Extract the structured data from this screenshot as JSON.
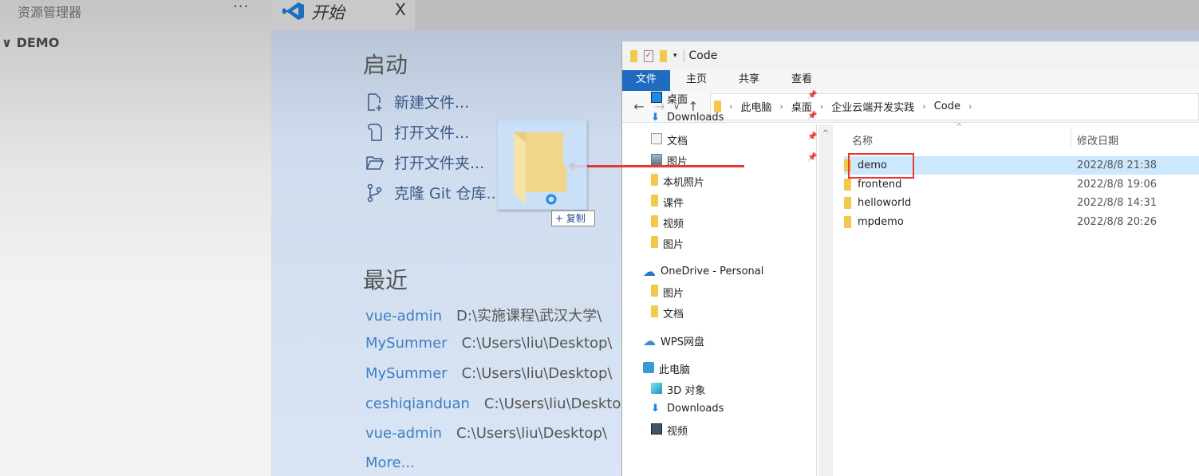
{
  "sidebar": {
    "title": "资源管理器",
    "more": "···",
    "folder": "DEMO"
  },
  "tab": {
    "label": "开始",
    "close": "X"
  },
  "start": {
    "heading": "启动",
    "items": [
      {
        "label": "新建文件...",
        "icon": "new-file-icon"
      },
      {
        "label": "打开文件...",
        "icon": "open-file-icon"
      },
      {
        "label": "打开文件夹...",
        "icon": "open-folder-icon"
      },
      {
        "label": "克隆 Git 仓库...",
        "icon": "git-branch-icon"
      }
    ]
  },
  "recent": {
    "heading": "最近",
    "items": [
      {
        "name": "vue-admin",
        "path": "D:\\实施课程\\武汉大学\\"
      },
      {
        "name": "MySummer",
        "path": "C:\\Users\\liu\\Desktop\\"
      },
      {
        "name": "MySummer",
        "path": "C:\\Users\\liu\\Desktop\\"
      },
      {
        "name": "ceshiqianduan",
        "path": "C:\\Users\\liu\\Desktop\\"
      },
      {
        "name": "vue-admin",
        "path": "C:\\Users\\liu\\Desktop\\"
      }
    ],
    "more": "More..."
  },
  "drag": {
    "tooltip": "+ 复制"
  },
  "explorer": {
    "title": "Code",
    "ribbon": [
      "文件",
      "主页",
      "共享",
      "查看"
    ],
    "breadcrumb": [
      "此电脑",
      "桌面",
      "企业云端开发实践",
      "Code"
    ],
    "nav_items": [
      {
        "label": "桌面",
        "icon": "desktop-icon",
        "pinned": true
      },
      {
        "label": "Downloads",
        "icon": "download-icon",
        "pinned": true
      },
      {
        "label": "文档",
        "icon": "document-icon",
        "pinned": true
      },
      {
        "label": "图片",
        "icon": "picture-icon",
        "pinned": true
      },
      {
        "label": "本机照片",
        "icon": "folder-icon"
      },
      {
        "label": "课件",
        "icon": "folder-icon"
      },
      {
        "label": "视频",
        "icon": "folder-icon"
      },
      {
        "label": "图片",
        "icon": "folder-icon"
      },
      {
        "label": "OneDrive - Personal",
        "icon": "onedrive-icon"
      },
      {
        "label": "图片",
        "icon": "folder-icon"
      },
      {
        "label": "文档",
        "icon": "folder-icon"
      },
      {
        "label": "WPS网盘",
        "icon": "cloud-icon"
      },
      {
        "label": "此电脑",
        "icon": "computer-icon"
      },
      {
        "label": "3D 对象",
        "icon": "3d-icon"
      },
      {
        "label": "Downloads",
        "icon": "download-icon"
      },
      {
        "label": "视频",
        "icon": "video-icon"
      }
    ],
    "columns": {
      "name": "名称",
      "date": "修改日期"
    },
    "files": [
      {
        "name": "demo",
        "date": "2022/8/8 21:38",
        "selected": true
      },
      {
        "name": "frontend",
        "date": "2022/8/8 19:06"
      },
      {
        "name": "helloworld",
        "date": "2022/8/8 14:31"
      },
      {
        "name": "mpdemo",
        "date": "2022/8/8 20:26"
      }
    ]
  },
  "colors": {
    "accent": "#1e6bbf",
    "highlight": "#e53935",
    "selection": "#cce8ff",
    "link": "#3d7ec4"
  }
}
